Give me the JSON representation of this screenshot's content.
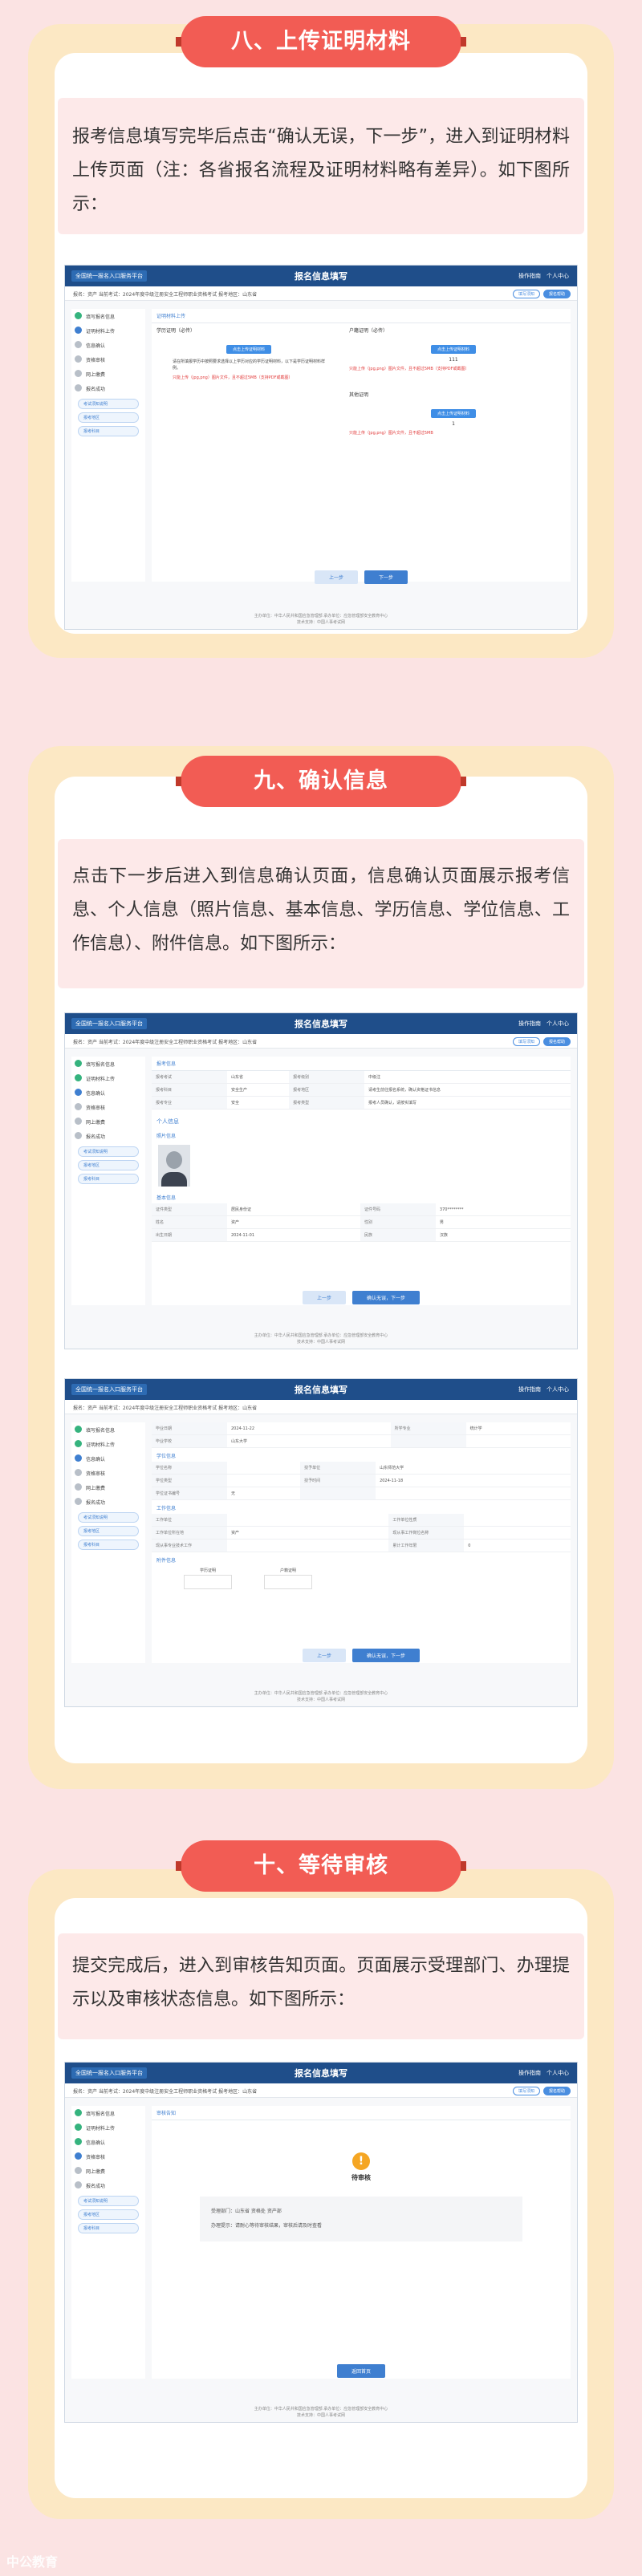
{
  "sections": [
    {
      "title": "八、上传证明材料",
      "text": "报考信息填写完毕后点击“确认无误，下一步”，进入到证明材料上传页面（注：各省报名流程及证明材料略有差异）。如下图所示："
    },
    {
      "title": "九、确认信息",
      "text": "点击下一步后进入到信息确认页面，信息确认页面展示报考信息、个人信息（照片信息、基本信息、学历信息、学位信息、工作信息）、附件信息。如下图所示："
    },
    {
      "title": "十、等待审核",
      "text": "提交完成后，进入到审核告知页面。页面展示受理部门、办理提示以及审核状态信息。如下图所示："
    }
  ],
  "app": {
    "logo": "全国统一报名入口服务平台",
    "title": "报名信息填写",
    "nav_help": "操作指南",
    "nav_user": "个人中心",
    "breadcrumb": "报名：资产   当前考试：2024年度中级注册安全工程师职业资格考试   报考地区：山东省",
    "btn_outline": "填写须知",
    "btn_fill": "报名帮助",
    "steps": [
      "填写报名信息",
      "证明材料上传",
      "信息确认",
      "资格审核",
      "网上缴费",
      "报名成功"
    ],
    "links": [
      "考试须知说明",
      "报考地区",
      "报考科目"
    ],
    "btn_prev": "上一步",
    "btn_next": "下一步",
    "btn_confirm_next": "确认无误，下一步",
    "footer1": "主办单位：中华人民共和国应急管理部   承办单位：应急管理部安全教育中心",
    "footer2": "技术支持：中国人事考试网"
  },
  "upload": {
    "panel_title": "证明材料上传",
    "edu_title": "学历证明（必传）",
    "edu_btn": "点击上传证明材料",
    "edu_desc": "请在所填报学历中按照要求选择以上学历对应的学历证明材料，以下是学历证明材料样例。",
    "edu_warn": "只能上传（jpg,png）图片文件，且不超过5MB（支持PDF或截图）",
    "id_title": "户籍证明（必传）",
    "id_btn": "点击上传证明材料",
    "id_count": "111",
    "id_warn": "只能上传（jpg,png）图片文件，且不超过5MB（支持PDF或截图）",
    "other_title": "其他证明",
    "other_btn": "点击上传证明材料",
    "other_count": "1",
    "other_warn": "只能上传（jpg,png）图片文件，且不超过5MB"
  },
  "confirm1": {
    "panel_title": "报考信息",
    "rows": [
      [
        "报考考试",
        "山东省",
        "报考级别",
        "中级注"
      ],
      [
        "报考科目",
        "安全生产",
        "报考地区",
        "请考生前往报名系统，确认资格证书信息"
      ],
      [
        "报考专业",
        "安全",
        "报考类型",
        "报考人员确认，请按实填写"
      ]
    ],
    "personal_title": "个人信息",
    "photo_title": "照片信息",
    "basic_title": "基本信息",
    "basic_rows": [
      [
        "证件类型",
        "居民身份证",
        "证件号码",
        "370********"
      ],
      [
        "姓名",
        "资产",
        "性别",
        "男"
      ],
      [
        "出生日期",
        "2024-11-01",
        "民族",
        "汉族"
      ]
    ]
  },
  "confirm2": {
    "rows_top": [
      [
        "毕业日期",
        "2024-11-22",
        "所学专业",
        "统计学"
      ],
      [
        "毕业学校",
        "山东大学",
        "",
        ""
      ]
    ],
    "degree_title": "学位信息",
    "degree_rows": [
      [
        "学位名称",
        "",
        "授予单位",
        "山东师范大学"
      ],
      [
        "学位类型",
        "",
        "授予时间",
        "2024-11-18"
      ],
      [
        "学位证书编号",
        "无",
        "",
        ""
      ]
    ],
    "work_title": "工作信息",
    "work_rows": [
      [
        "工作单位",
        "",
        "工作单位性质",
        ""
      ],
      [
        "工作单位所在地",
        "资产",
        "现从事工作岗位名称",
        ""
      ],
      [
        "现从事专业技术工作",
        "",
        "累计工作年限",
        "0"
      ]
    ],
    "attach_title": "附件信息",
    "attach_cols": [
      "学历证明",
      "户籍证明"
    ]
  },
  "review": {
    "panel_title": "审核告知",
    "status": "待审核",
    "dept_label": "受理部门：",
    "dept_value": "山东省 资格处 资产部",
    "tip_label": "办理提示：",
    "tip_value": "请耐心等待审核结果，审核后请及时查看",
    "btn_back": "返回首页"
  },
  "watermark": "中公教育"
}
